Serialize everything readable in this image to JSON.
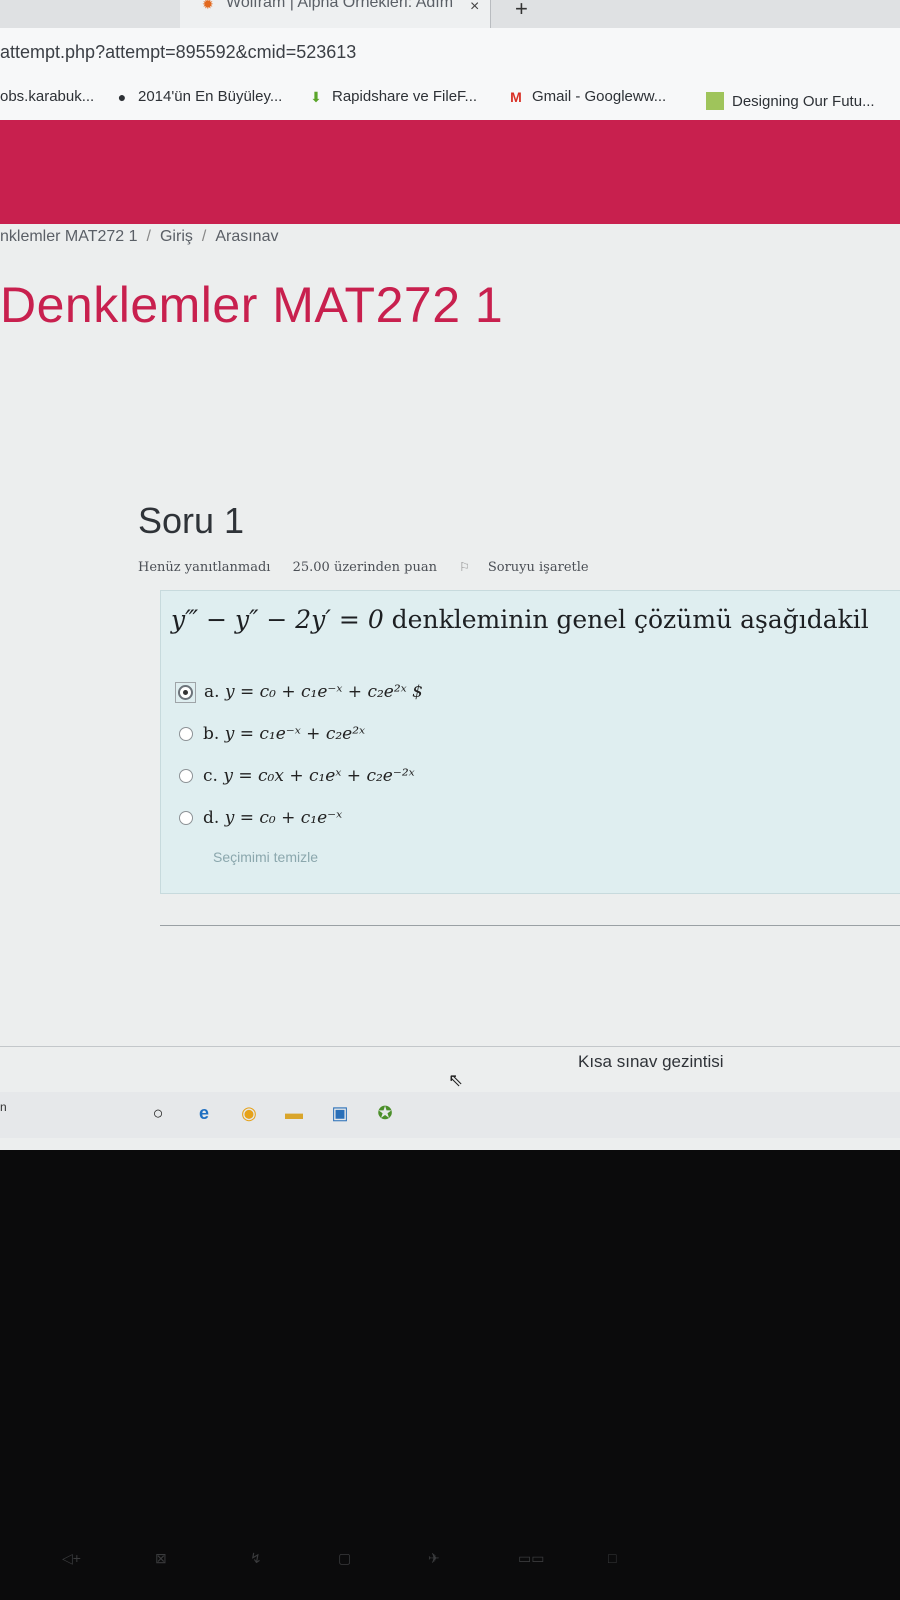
{
  "browser": {
    "tab_title": "Wolfram | Alpha Örnekleri: Adım",
    "tab_close": "×",
    "new_tab": "+",
    "url": "attempt.php?attempt=895592&cmid=523613",
    "bookmarks": [
      {
        "label": "obs.karabuk...",
        "icon": "none"
      },
      {
        "label": "2014'ün En Büyüley...",
        "icon": "dark-drop-icon"
      },
      {
        "label": "Rapidshare ve FileF...",
        "icon": "download-arrow-icon"
      },
      {
        "label": "Gmail - Googleww...",
        "icon": "gmail-icon"
      },
      {
        "label": "Designing Our Futu...",
        "icon": "page-icon"
      }
    ]
  },
  "site": {
    "header_color": "#c8204e",
    "breadcrumb": [
      "nklemler MAT272 1",
      "Giriş",
      "Arasınav"
    ],
    "breadcrumb_sep": "/",
    "title": "Denklemler MAT272 1"
  },
  "question": {
    "heading": "Soru 1",
    "status": "Henüz yanıtlanmadı",
    "points": "25.00 üzerinden puan",
    "flag_label": "Soruyu işaretle",
    "text_equation": "y‴ − y″ − 2y′ = 0",
    "text_rest": " denkleminin genel çözümü aşağıdakil",
    "answers": [
      {
        "letter": "a.",
        "formula": "y = c₀ + c₁e⁻ˣ + c₂e²ˣ $",
        "selected": true
      },
      {
        "letter": "b.",
        "formula": "y = c₁e⁻ˣ + c₂e²ˣ",
        "selected": false
      },
      {
        "letter": "c.",
        "formula": "y = c₀x + c₁eˣ + c₂e⁻²ˣ",
        "selected": false
      },
      {
        "letter": "d.",
        "formula": "y = c₀ + c₁e⁻ˣ",
        "selected": false
      }
    ],
    "clear_label": "Seçimimi temizle"
  },
  "footer": {
    "quiz_nav": "Kısa sınav gezintisi"
  },
  "taskbar": {
    "left_text": "n",
    "icons": [
      "cortana-circle-icon",
      "edge-icon",
      "chrome-icon",
      "file-explorer-icon",
      "photos-icon",
      "store-icon"
    ]
  }
}
